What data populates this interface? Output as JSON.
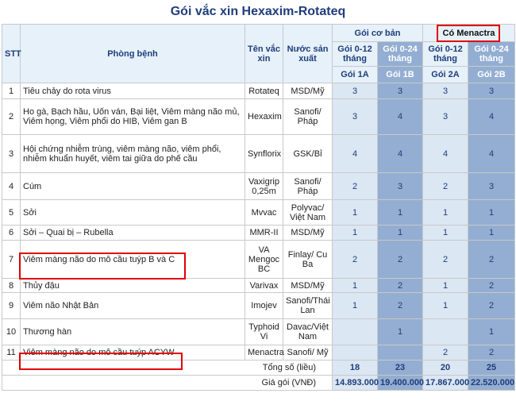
{
  "title": "Gói vắc xin Hexaxim-Rotateq",
  "headers": {
    "stt": "STT",
    "disease": "Phòng bệnh",
    "vaccine": "Tên vắc xin",
    "country": "Nước sản xuất",
    "group_basic": "Gói cơ bản",
    "group_menactra": "Có Menactra",
    "pkg": [
      "Gói 0-12 tháng",
      "Gói 0-24 tháng",
      "Gói 0-12 tháng",
      "Gói 0-24 tháng"
    ],
    "pkg_code": [
      "Gói 1A",
      "Gói 1B",
      "Gói 2A",
      "Gói 2B"
    ]
  },
  "rows": [
    {
      "stt": "1",
      "disease": "Tiêu chảy do rota virus",
      "vaccine": "Rotateq",
      "country": "MSD/Mỹ",
      "a": "3",
      "b": "3",
      "c": "3",
      "d": "3"
    },
    {
      "stt": "2",
      "disease": "Ho gà, Bạch hầu, Uốn ván, Bại liệt, Viêm màng não mủ, Viêm họng, Viêm phổi do HIB, Viêm gan B",
      "vaccine": "Hexaxim",
      "country": "Sanofi/ Pháp",
      "a": "3",
      "b": "4",
      "c": "3",
      "d": "4"
    },
    {
      "stt": "3",
      "disease": "Hội chứng nhiễm trùng, viêm màng não, viêm phổi, nhiễm khuẩn huyết, viêm tai giữa do phế cầu",
      "vaccine": "Synflorix",
      "country": "GSK/Bỉ",
      "a": "4",
      "b": "4",
      "c": "4",
      "d": "4"
    },
    {
      "stt": "4",
      "disease": "Cúm",
      "vaccine": "Vaxigrip 0,25m",
      "country": "Sanofi/ Pháp",
      "a": "2",
      "b": "3",
      "c": "2",
      "d": "3"
    },
    {
      "stt": "5",
      "disease": "Sởi",
      "vaccine": "Mvvac",
      "country": "Polyvac/ Việt Nam",
      "a": "1",
      "b": "1",
      "c": "1",
      "d": "1"
    },
    {
      "stt": "6",
      "disease": "Sởi – Quai bị – Rubella",
      "vaccine": "MMR-II",
      "country": "MSD/Mỹ",
      "a": "1",
      "b": "1",
      "c": "1",
      "d": "1"
    },
    {
      "stt": "7",
      "disease": "Viêm màng não do mô cầu tuýp B và C",
      "vaccine": "VA Mengoc BC",
      "country": "Finlay/ Cu Ba",
      "a": "2",
      "b": "2",
      "c": "2",
      "d": "2"
    },
    {
      "stt": "8",
      "disease": "Thủy đậu",
      "vaccine": "Varivax",
      "country": "MSD/Mỹ",
      "a": "1",
      "b": "2",
      "c": "1",
      "d": "2"
    },
    {
      "stt": "9",
      "disease": "Viêm não Nhật Bản",
      "vaccine": "Imojev",
      "country": "Sanofi/Thái Lan",
      "a": "1",
      "b": "2",
      "c": "1",
      "d": "2"
    },
    {
      "stt": "10",
      "disease": "Thương hàn",
      "vaccine": "Typhoid Vi",
      "country": "Davac/Việt Nam",
      "a": "",
      "b": "1",
      "c": "",
      "d": "1"
    },
    {
      "stt": "11",
      "disease": "Viêm màng não do mô cầu tuýp ACYW",
      "vaccine": "Menactra",
      "country": "Sanofi/ Mỹ",
      "a": "",
      "b": "",
      "c": "2",
      "d": "2"
    }
  ],
  "totals": {
    "label": "Tổng số (liều)",
    "a": "18",
    "b": "23",
    "c": "20",
    "d": "25"
  },
  "price": {
    "label": "Giá gói (VNĐ)",
    "a": "14.893.000",
    "b": "19.400.000",
    "c": "17.867.000",
    "d": "22.520.000"
  }
}
